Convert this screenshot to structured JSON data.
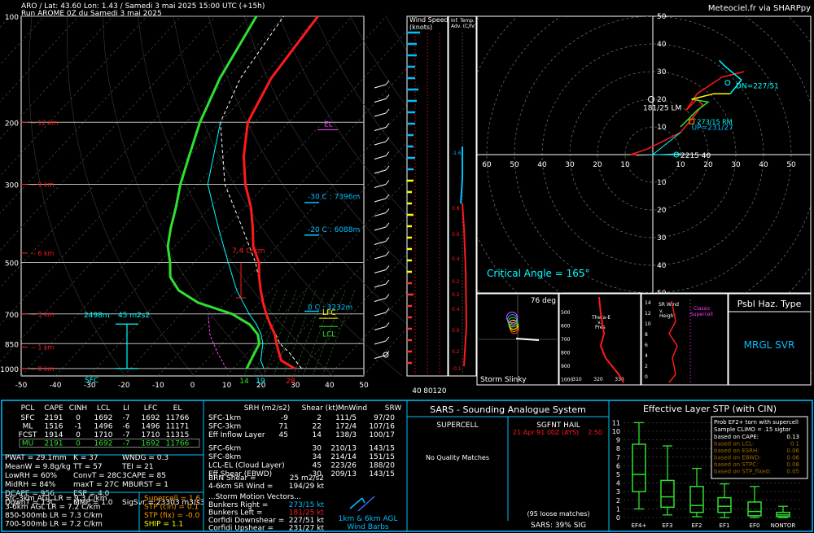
{
  "header": {
    "line1": "ARO / Lat: 43.60 Lon: 1.43 / Samedi 3 mai 2025 15:00 UTC (+15h)",
    "line2": "Run AROME 0Z du Samedi 3 mai 2025",
    "credit": "Meteociel.fr via SHARPpy"
  },
  "colors": {
    "temp": "#ff1a1a",
    "dewpoint": "#2fe02f",
    "parcel": "#ffffff",
    "wetbulb": "#00ffff",
    "accent": "#00bfff",
    "yellow": "#ffff00",
    "magenta": "#ff40ff"
  },
  "chart_data": [
    {
      "type": "line",
      "name": "skew-t",
      "pressure_labels": [
        "100",
        "200",
        "300",
        "500",
        "700",
        "850",
        "1000"
      ],
      "x_ticks": [
        "-50",
        "-40",
        "-30",
        "-20",
        "-10",
        "0",
        "10",
        "20",
        "30",
        "40",
        "50"
      ],
      "height_labels": [
        "12 km",
        "9 km",
        "6 km",
        "3 km",
        "1 km",
        "0 km"
      ],
      "temperature_profile": {
        "pressure": [
          1000,
          950,
          900,
          850,
          800,
          750,
          700,
          650,
          600,
          550,
          500,
          450,
          400,
          350,
          300,
          250,
          200,
          150,
          100
        ],
        "temp_c": [
          28,
          22,
          19,
          16,
          13,
          9,
          5,
          1,
          -3,
          -7,
          -11,
          -17,
          -22,
          -28,
          -36,
          -44,
          -52,
          -57,
          -60
        ]
      },
      "dewpoint_profile": {
        "pressure": [
          1000,
          950,
          900,
          850,
          800,
          750,
          700,
          650,
          600,
          550,
          500,
          450,
          400,
          350,
          300,
          250,
          200,
          150,
          100
        ],
        "temp_c": [
          14,
          13,
          12,
          11,
          8,
          3,
          -5,
          -18,
          -27,
          -33,
          -37,
          -42,
          -46,
          -50,
          -55,
          -60,
          -66,
          -72,
          -78
        ]
      },
      "annotations": {
        "el": "EL",
        "lfc": "LFC",
        "lcl": "LCL",
        "lapse": "7.4 C/km",
        "iso30": "-30 C : 7396m",
        "iso20": "-20 C : 6088m",
        "iso0": "0 C : 3232m",
        "eff_inflow": "2498m",
        "srh_label": "45 m2s2",
        "sfc": "SFC",
        "bottom_vals": [
          "14",
          "19",
          "28"
        ]
      }
    },
    {
      "type": "line",
      "name": "hodograph",
      "ring_labels": [
        "10",
        "20",
        "30",
        "40",
        "50",
        "60"
      ],
      "axis_ticks": [
        "60",
        "50",
        "40",
        "30",
        "20",
        "10",
        "10",
        "20",
        "30",
        "40",
        "50",
        "60"
      ],
      "labels": {
        "lm": "181/25 LM",
        "rm": "273/15 RM",
        "up": "UP=231/27",
        "dn": "DN=227/51",
        "ticks": "2215 40",
        "critical": "Critical Angle = 165°"
      }
    }
  ],
  "windspeed_panel": {
    "title1": "Wind Speed",
    "title2": "(knots)",
    "ticks": [
      "40",
      "80",
      "120"
    ]
  },
  "inferred_panel": {
    "title1": "Inf. Temp.",
    "title2": "Adv. (C/hr)",
    "vals": [
      "-1.6",
      "0.8",
      "0.6",
      "0.4",
      "0.2",
      "0.2",
      "0.4",
      "0.6",
      "0.2",
      "-0.1"
    ]
  },
  "mini_panels": {
    "slinky_deg": "76 deg",
    "slinky": "Storm Slinky",
    "thetae": "Theta-E v. Pres",
    "thetae_ticks": [
      "310",
      "320",
      "330"
    ],
    "srwind": "SR Wind v. Height",
    "classic": "Classic Supercell"
  },
  "hazard": {
    "title": "Psbl Haz. Type",
    "value": "MRGL SVR"
  },
  "parcels": {
    "headers": [
      "PCL",
      "CAPE",
      "CINH",
      "LCL",
      "LI",
      "LFC",
      "EL"
    ],
    "rows": [
      [
        "SFC",
        "2191",
        "0",
        "1692",
        "-7",
        "1692",
        "11766"
      ],
      [
        "ML",
        "1516",
        "-1",
        "1496",
        "-6",
        "1496",
        "11171"
      ],
      [
        "FCST",
        "1914",
        "0",
        "1710",
        "-7",
        "1710",
        "11315"
      ],
      [
        "MU",
        "2191",
        "0",
        "1692",
        "-7",
        "1692",
        "11766"
      ]
    ]
  },
  "indices": [
    [
      "PWAT = 29.1mm",
      "K = 37",
      "WNDG = 0.3"
    ],
    [
      "MeanW = 9.8g/kg",
      "TT = 57",
      "TEI = 21"
    ],
    [
      "LowRH = 60%",
      "ConvT = 28C",
      "3CAPE = 85"
    ],
    [
      "MidRH = 84%",
      "maxT = 27C",
      "MBURST = 1"
    ],
    [
      "DCAPE = 956",
      "ESP = 4.0",
      ""
    ],
    [
      "DownT = 13C",
      "MMP = 1.0",
      "SigSvr = 23303 m3/s3"
    ]
  ],
  "lapse": [
    "Sfc-3km AGL LR = 9.3 C/km",
    "3-6km AGL LR = 7.2 C/km",
    "850-500mb LR = 7.3 C/km",
    "700-500mb LR = 7.2 C/km"
  ],
  "composites": [
    "Supercell = 1.6",
    "STP (cin) = 0.1",
    "STP (fix) = -0.0",
    "SHIP = 1.1"
  ],
  "kinematics": {
    "headers": [
      "SRH (m2/s2)",
      "Shear (kt)",
      "MnWind",
      "SRW"
    ],
    "rows": [
      [
        "SFC-1km",
        "-9",
        "2",
        "111/5",
        "97/20"
      ],
      [
        "SFC-3km",
        "71",
        "22",
        "172/4",
        "107/16"
      ],
      [
        "Eff Inflow Layer",
        "45",
        "14",
        "138/3",
        "100/17"
      ],
      [
        "SFC-6km",
        "",
        "30",
        "210/13",
        "143/15"
      ],
      [
        "SFC-8km",
        "",
        "34",
        "214/14",
        "151/15"
      ],
      [
        "LCL-EL (Cloud Layer)",
        "",
        "45",
        "223/26",
        "188/20"
      ],
      [
        "Eff Shear (EBWD)",
        "",
        "30",
        "209/13",
        "143/15"
      ]
    ],
    "brn": "BRN Shear =",
    "brn_val": "25 m2/s2",
    "srw": "4-6km SR Wind =",
    "srw_val": "194/29 kt",
    "sm_title": "...Storm Motion Vectors...",
    "motions": [
      [
        "Bunkers Right =",
        "273/15 kt"
      ],
      [
        "Bunkers Left =",
        "181/25 kt"
      ],
      [
        "Corfidi Downshear =",
        "227/51 kt"
      ],
      [
        "Corfidi Upshear =",
        "231/27 kt"
      ]
    ],
    "barbs_label1": "1km & 6km AGL",
    "barbs_label2": "Wind Barbs"
  },
  "sars": {
    "title": "SARS - Sounding Analogue System",
    "supercell": "SUPERCELL",
    "hail": "SGFNT HAIL",
    "hail_match": "21 Apr 91 00Z (AYS)",
    "hail_val": "2.50",
    "no_match": "No Quality Matches",
    "loose": "(95 loose matches)",
    "sig": "SARS: 39% SIG"
  },
  "stp": {
    "title": "Effective Layer STP (with CIN)",
    "yticks": [
      "0",
      "1",
      "2",
      "3",
      "4",
      "5",
      "6",
      "7",
      "8",
      "9",
      "10",
      "11"
    ],
    "cats": [
      "EF4+",
      "EF3",
      "EF2",
      "EF1",
      "EF0",
      "NONTOR"
    ],
    "boxes": [
      {
        "wlo": 1.0,
        "q1": 3.0,
        "med": 5.0,
        "q3": 8.5,
        "whi": 11.0
      },
      {
        "wlo": 0.3,
        "q1": 1.2,
        "med": 2.4,
        "q3": 4.3,
        "whi": 8.3
      },
      {
        "wlo": 0.1,
        "q1": 0.6,
        "med": 1.4,
        "q3": 3.6,
        "whi": 5.7
      },
      {
        "wlo": 0.0,
        "q1": 0.6,
        "med": 1.3,
        "q3": 2.3,
        "whi": 3.9
      },
      {
        "wlo": 0.0,
        "q1": 0.2,
        "med": 0.7,
        "q3": 1.8,
        "whi": 3.6
      },
      {
        "wlo": 0.0,
        "q1": 0.1,
        "med": 0.3,
        "q3": 0.6,
        "whi": 1.3
      }
    ],
    "legend": [
      "Prob EF2+ torn with supercell",
      "Sample CLIMO = .15 sigtor"
    ],
    "legend_rows": [
      [
        "based on CAPE:",
        "0.13"
      ],
      [
        "based on LCL:",
        "0.1"
      ],
      [
        "based on ESRH:",
        "0.06"
      ],
      [
        "based on EBWD:",
        "0.06"
      ],
      [
        "based on STPC:",
        "0.08"
      ],
      [
        "based on STP_fixed:",
        "0.05"
      ]
    ]
  }
}
